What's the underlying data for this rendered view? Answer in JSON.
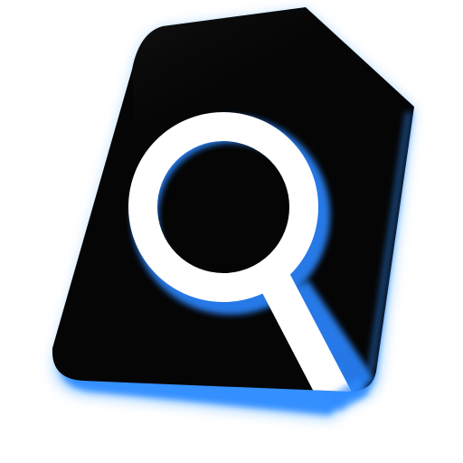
{
  "app_icon": {
    "icon_name": "file-search-icon",
    "colors": {
      "background": "#ffffff",
      "document_fill": "#050505",
      "document_gloss": "#1e1e1e",
      "glow_outer": "#8fc8ff",
      "glow_inner": "#2f8cff",
      "lens_ring": "#ffffff",
      "lens_ring_shadow": "#2b86ff",
      "handle": "#ffffff"
    }
  }
}
